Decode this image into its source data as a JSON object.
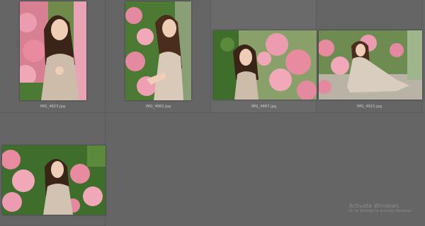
{
  "photos": [
    {
      "filename": "IMG_4823.jpg"
    },
    {
      "filename": "IMG_4882.jpg"
    },
    {
      "filename": "IMG_4887.jpg"
    },
    {
      "filename": "IMG_4915.jpg"
    },
    {
      "filename": ""
    }
  ],
  "watermark": {
    "title": "Activate Windows",
    "subtitle": "Go to Settings to activate Windows."
  },
  "colors": {
    "background": "#656565",
    "flower_pink": "#e88aa0",
    "foliage_green": "#3f6e2c",
    "dress": "#cdbcaa"
  }
}
